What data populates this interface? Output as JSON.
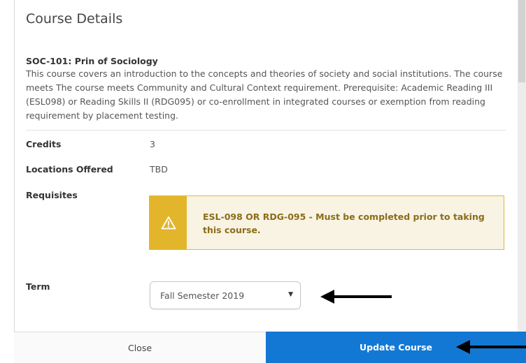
{
  "dialog": {
    "title": "Course Details"
  },
  "course": {
    "name": "SOC-101: Prin of Sociology",
    "description": "This course covers an introduction to the concepts and theories of society and social institutions. The course meets The course meets Community and Cultural Context requirement. Prerequisite: Academic Reading III (ESL098) or Reading Skills II (RDG095) or co-enrollment in integrated courses or exemption from reading requirement by placement testing."
  },
  "details": {
    "credits_label": "Credits",
    "credits_value": "3",
    "locations_label": "Locations Offered",
    "locations_value": "TBD",
    "requisites_label": "Requisites",
    "requisite_warning": "ESL-098 OR RDG-095 - Must be completed prior to taking this course.",
    "warning_icon": "warning-triangle-icon",
    "term_label": "Term",
    "term_selected": "Fall Semester 2019"
  },
  "footer": {
    "close_label": "Close",
    "update_label": "Update Course"
  },
  "colors": {
    "primary": "#1378d3",
    "warning_icon_bg": "#e3b52b",
    "warning_bg": "#f8f3e2",
    "warning_text": "#8a6d1a"
  }
}
